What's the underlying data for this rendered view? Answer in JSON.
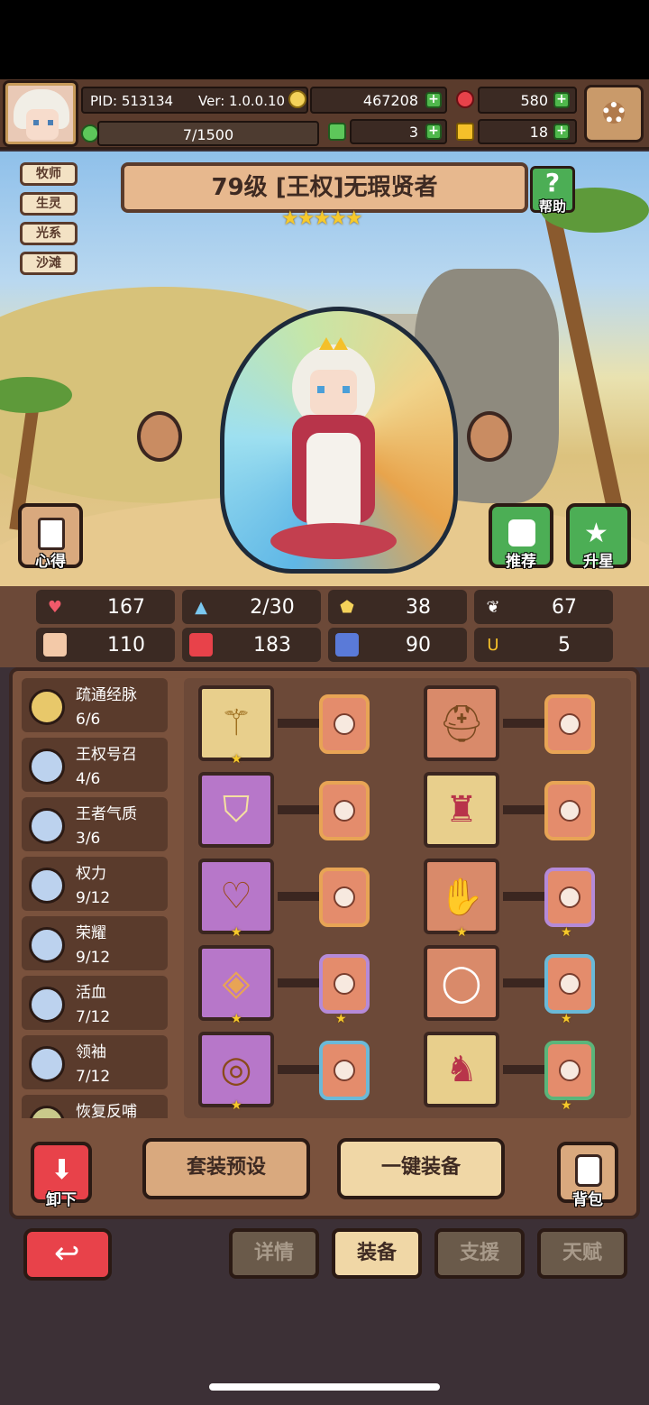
{
  "hud": {
    "pid": "PID: 513134",
    "version": "Ver: 1.0.0.10",
    "gold": "467208",
    "gems": "580",
    "exp": "7/1500",
    "clover": "3",
    "key": "18"
  },
  "tags": [
    "牧师",
    "生灵",
    "光系",
    "沙滩"
  ],
  "hero": {
    "title": "79级 [王权]无瑕贤者",
    "stars": "★★★★★",
    "help_icon": "?",
    "help_label": "帮助"
  },
  "side_buttons": {
    "insight": "心得",
    "recommend": "推荐",
    "star_up": "升星"
  },
  "stats": [
    {
      "icon": "heart-icon",
      "value": "167"
    },
    {
      "icon": "water-drop-icon",
      "value": "2/30"
    },
    {
      "icon": "shield-icon",
      "value": "38"
    },
    {
      "icon": "wing-icon",
      "value": "67"
    },
    {
      "icon": "fist-icon",
      "value": "110"
    },
    {
      "icon": "book-icon",
      "value": "183"
    },
    {
      "icon": "boot-icon",
      "value": "90"
    },
    {
      "icon": "horseshoe-icon",
      "value": "5"
    }
  ],
  "skills": [
    {
      "name": "疏通经脉",
      "level": "6/6"
    },
    {
      "name": "王权号召",
      "level": "4/6"
    },
    {
      "name": "王者气质",
      "level": "3/6"
    },
    {
      "name": "权力",
      "level": "9/12"
    },
    {
      "name": "荣耀",
      "level": "9/12"
    },
    {
      "name": "活血",
      "level": "7/12"
    },
    {
      "name": "领袖",
      "level": "7/12"
    },
    {
      "name": "恢复反哺",
      "level": ""
    }
  ],
  "actions": {
    "unequip": "卸下",
    "preset": "套装预设",
    "equip_all": "一键装备",
    "bag": "背包"
  },
  "tabs": [
    "详情",
    "装备",
    "支援",
    "天赋"
  ],
  "colors": {
    "accent": "#e7b88e",
    "gold": "#f6c92b",
    "green": "#4fb84c"
  }
}
